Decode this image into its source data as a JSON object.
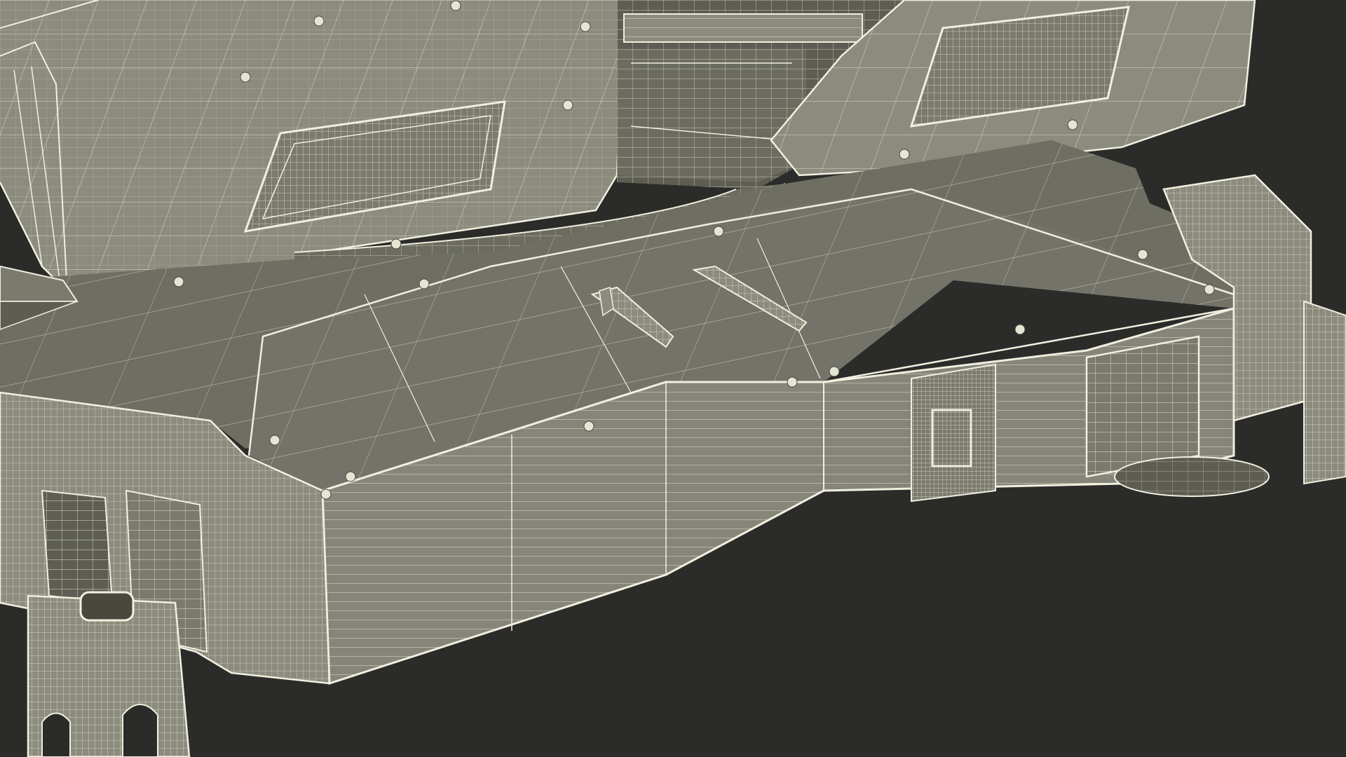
{
  "scene": {
    "subject": "wireframe-3d-model",
    "colors": {
      "background": "#2b2b2a",
      "surface_light": "#8c8c7e",
      "surface_mid": "#7a7a6d",
      "surface_dark": "#5d5d53",
      "surface_shadow": "#48483f",
      "wire": "#f1efdf",
      "bolt": "#e6e4d4"
    }
  }
}
